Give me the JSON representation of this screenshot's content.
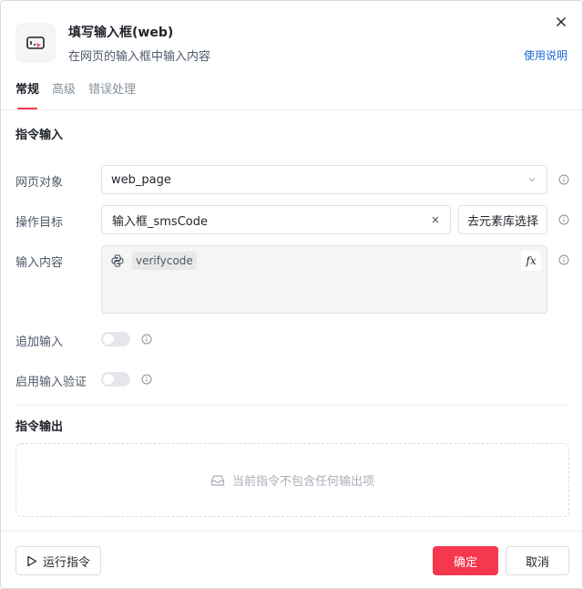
{
  "header": {
    "title": "填写输入框(web)",
    "subtitle": "在网页的输入框中输入内容",
    "help_link": "使用说明",
    "icon": "browser-input-icon",
    "close_icon": "close-icon"
  },
  "tabs": [
    {
      "label": "常规",
      "active": true
    },
    {
      "label": "高级",
      "active": false
    },
    {
      "label": "错误处理",
      "active": false
    }
  ],
  "input_section": {
    "title": "指令输入",
    "fields": {
      "page_object": {
        "label": "网页对象",
        "value": "web_page"
      },
      "target": {
        "label": "操作目标",
        "value": "输入框_smsCode",
        "pick_button": "去元素库选择"
      },
      "content": {
        "label": "输入内容",
        "variable": "verifycode",
        "fx_label": "fx"
      },
      "append": {
        "label": "追加输入",
        "enabled": false
      },
      "validate": {
        "label": "启用输入验证",
        "enabled": false
      }
    }
  },
  "output_section": {
    "title": "指令输出",
    "empty_text": "当前指令不包含任何输出项"
  },
  "footer": {
    "run_label": "运行指令",
    "ok_label": "确定",
    "cancel_label": "取消"
  },
  "colors": {
    "accent": "#f5384d",
    "link": "#1a66d9"
  }
}
